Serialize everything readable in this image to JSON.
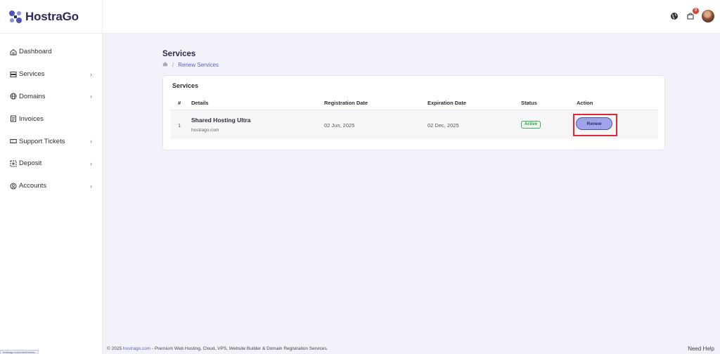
{
  "brand": {
    "name": "HostraGo",
    "logo_icon": "hostrago-logo-icon",
    "accent": "#5a60c8"
  },
  "sidebar": {
    "items": [
      {
        "label": "Dashboard",
        "icon": "home-icon",
        "has_chevron": false
      },
      {
        "label": "Services",
        "icon": "server-icon",
        "has_chevron": true
      },
      {
        "label": "Domains",
        "icon": "globe-icon",
        "has_chevron": true
      },
      {
        "label": "Invoices",
        "icon": "invoice-icon",
        "has_chevron": false
      },
      {
        "label": "Support Tickets",
        "icon": "ticket-icon",
        "has_chevron": true
      },
      {
        "label": "Deposit",
        "icon": "deposit-icon",
        "has_chevron": true
      },
      {
        "label": "Accounts",
        "icon": "user-circle-icon",
        "has_chevron": true
      }
    ]
  },
  "topbar": {
    "cart_count": "0",
    "icons": [
      "globe-icon",
      "cart-icon",
      "avatar"
    ]
  },
  "page": {
    "title": "Services",
    "breadcrumb": {
      "home_icon": "home-icon",
      "separator": "/",
      "current": "Renew Services"
    }
  },
  "card": {
    "title": "Services",
    "headers": [
      "#",
      "Details",
      "Registration Date",
      "Expiration Date",
      "Status",
      "Action"
    ],
    "rows": [
      {
        "index": "1",
        "service_name": "Shared Hosting Ultra",
        "domain": "hostrago.com",
        "registration_date": "02 Jun, 2025",
        "expiration_date": "02 Dec, 2025",
        "status": "Active",
        "action": "Renew"
      }
    ]
  },
  "footer": {
    "prefix": "© 2025 ",
    "site": "hostrago.com",
    "suffix": " - Premium Web Hosting, Cloud, VPS, Website Builder & Domain Registration Services.",
    "help": "Need Help"
  },
  "status_bar": {
    "url": "hostrago.com/user/renew..."
  }
}
